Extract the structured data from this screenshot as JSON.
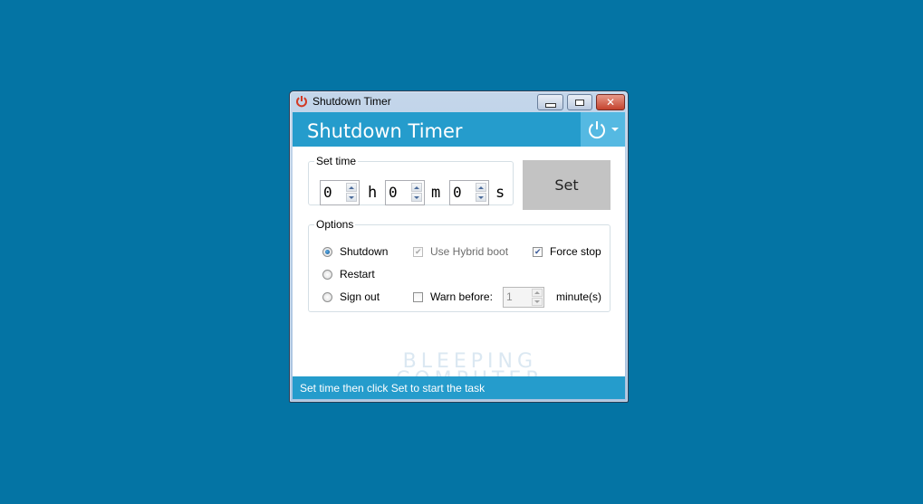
{
  "window": {
    "title": "Shutdown Timer",
    "controls": {
      "minimize": "minimize",
      "maximize": "maximize",
      "close": "close"
    }
  },
  "header": {
    "title": "Shutdown Timer",
    "menu_icon": "power-icon"
  },
  "set_time": {
    "legend": "Set time",
    "hours": {
      "value": "0",
      "unit": "h"
    },
    "minutes": {
      "value": "0",
      "unit": "m"
    },
    "seconds": {
      "value": "0",
      "unit": "s"
    }
  },
  "set_button_label": "Set",
  "options": {
    "legend": "Options",
    "actions": [
      {
        "label": "Shutdown",
        "checked": true
      },
      {
        "label": "Restart",
        "checked": false
      },
      {
        "label": "Sign out",
        "checked": false
      }
    ],
    "use_hybrid_boot": {
      "label": "Use Hybrid boot",
      "checked": true,
      "enabled": false
    },
    "force_stop": {
      "label": "Force stop",
      "checked": true
    },
    "warn_before": {
      "label": "Warn before:",
      "checked": false,
      "value": "1",
      "unit": "minute(s)"
    }
  },
  "watermark": {
    "line1": "BLEEPING",
    "line2": "COMPUTER"
  },
  "status": "Set time then click Set to start the task",
  "colors": {
    "desktop": "#0474a4",
    "accent": "#259ccc",
    "accent_light": "#55b9e2",
    "set_button": "#c3c3c3"
  }
}
